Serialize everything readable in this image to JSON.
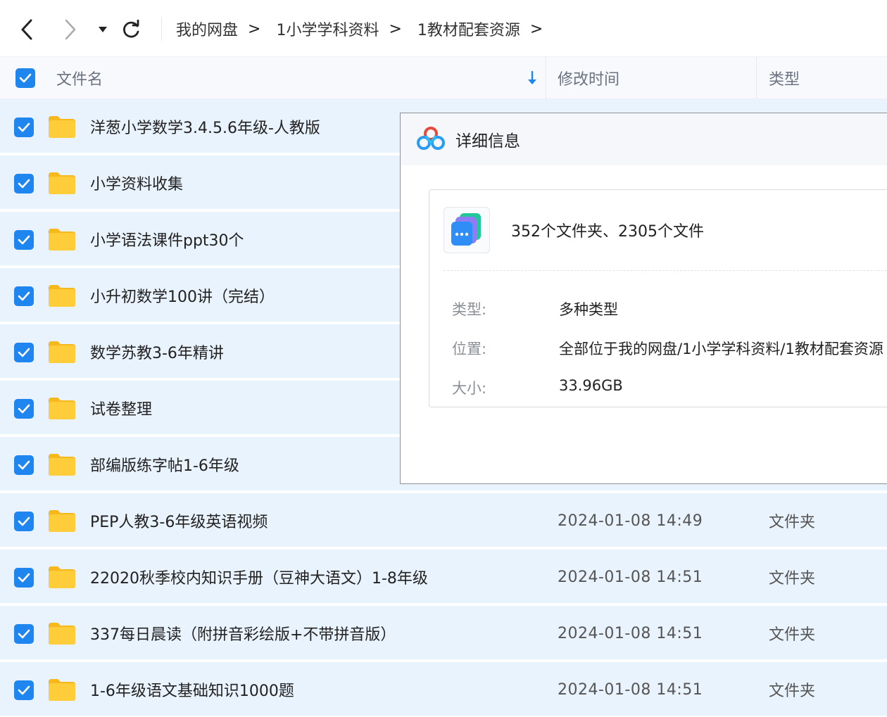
{
  "breadcrumb": {
    "items": [
      "我的网盘",
      "1小学学科资料",
      "1教材配套资源"
    ],
    "separator": ">"
  },
  "header": {
    "name_label": "文件名",
    "modified_label": "修改时间",
    "type_label": "类型"
  },
  "files": [
    {
      "name": "洋葱小学数学3.4.5.6年级-人教版",
      "modified": "",
      "type": ""
    },
    {
      "name": "小学资料收集",
      "modified": "",
      "type": ""
    },
    {
      "name": "小学语法课件ppt30个",
      "modified": "",
      "type": ""
    },
    {
      "name": "小升初数学100讲（完结）",
      "modified": "",
      "type": ""
    },
    {
      "name": "数学苏教3-6年精讲",
      "modified": "",
      "type": ""
    },
    {
      "name": "试卷整理",
      "modified": "",
      "type": ""
    },
    {
      "name": "部编版练字帖1-6年级",
      "modified": "",
      "type": ""
    },
    {
      "name": "PEP人教3-6年级英语视频",
      "modified": "2024-01-08 14:49",
      "type": "文件夹"
    },
    {
      "name": "22020秋季校内知识手册（豆神大语文）1-8年级",
      "modified": "2024-01-08 14:51",
      "type": "文件夹"
    },
    {
      "name": "337每日晨读（附拼音彩绘版+不带拼音版）",
      "modified": "2024-01-08 14:51",
      "type": "文件夹"
    },
    {
      "name": "1-6年级语文基础知识1000题",
      "modified": "2024-01-08 14:51",
      "type": "文件夹"
    }
  ],
  "details": {
    "title": "详细信息",
    "summary": "352个文件夹、2305个文件",
    "type_label": "类型:",
    "type_value": "多种类型",
    "location_label": "位置:",
    "location_value": "全部位于我的网盘/1小学学科资料/1教材配套资源",
    "size_label": "大小:",
    "size_value": "33.96GB"
  },
  "colors": {
    "accent": "#1f86f0",
    "row_selected": "#e9f3fd",
    "folder": "#ffc933"
  }
}
